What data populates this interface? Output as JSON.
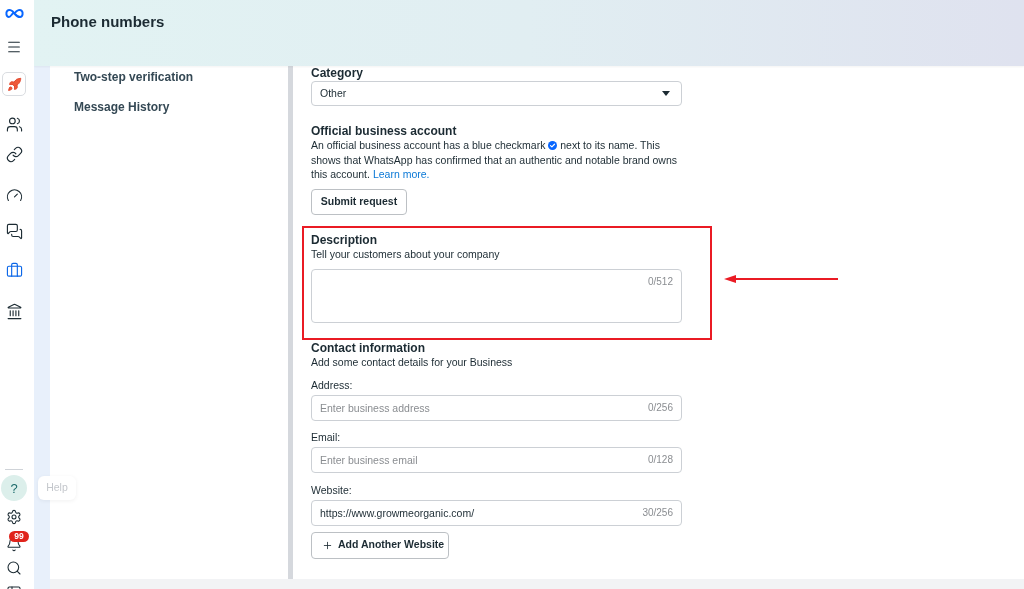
{
  "header": {
    "title": "Phone numbers"
  },
  "rail": {
    "nav": [
      {
        "selected": false
      },
      {
        "selected": false
      },
      {
        "selected": false
      },
      {
        "selected": false
      },
      {
        "selected": true
      },
      {
        "selected": false
      }
    ],
    "help": {
      "label": "?",
      "highlighted": true,
      "tooltip": "Help"
    },
    "notification_badge": "99"
  },
  "side_menu": {
    "items": [
      {
        "label": "Two-step verification",
        "selected": false
      },
      {
        "label": "Message History",
        "selected": false
      }
    ]
  },
  "form": {
    "category": {
      "label": "Category",
      "value": "Other"
    },
    "official_account": {
      "title": "Official business account",
      "text_before": "An official business account has a blue checkmark",
      "text_after": "next to its name. This shows that WhatsApp has confirmed that an authentic and notable brand owns this account.",
      "link": "Learn more.",
      "button": "Submit request"
    },
    "description": {
      "title": "Description",
      "hint": "Tell your customers about your company",
      "counter": "0/512",
      "highlighted": true
    },
    "contact": {
      "title": "Contact information",
      "hint": "Add some contact details for your Business",
      "fields": [
        {
          "label": "Address:",
          "placeholder": "Enter business address",
          "counter": "0/256"
        },
        {
          "label": "Email:",
          "placeholder": "Enter business email",
          "counter": "0/128"
        },
        {
          "label": "Website:",
          "value": "https://www.growmeorganic.com/",
          "counter": "30/256"
        }
      ],
      "add_button": "Add Another Website"
    }
  }
}
